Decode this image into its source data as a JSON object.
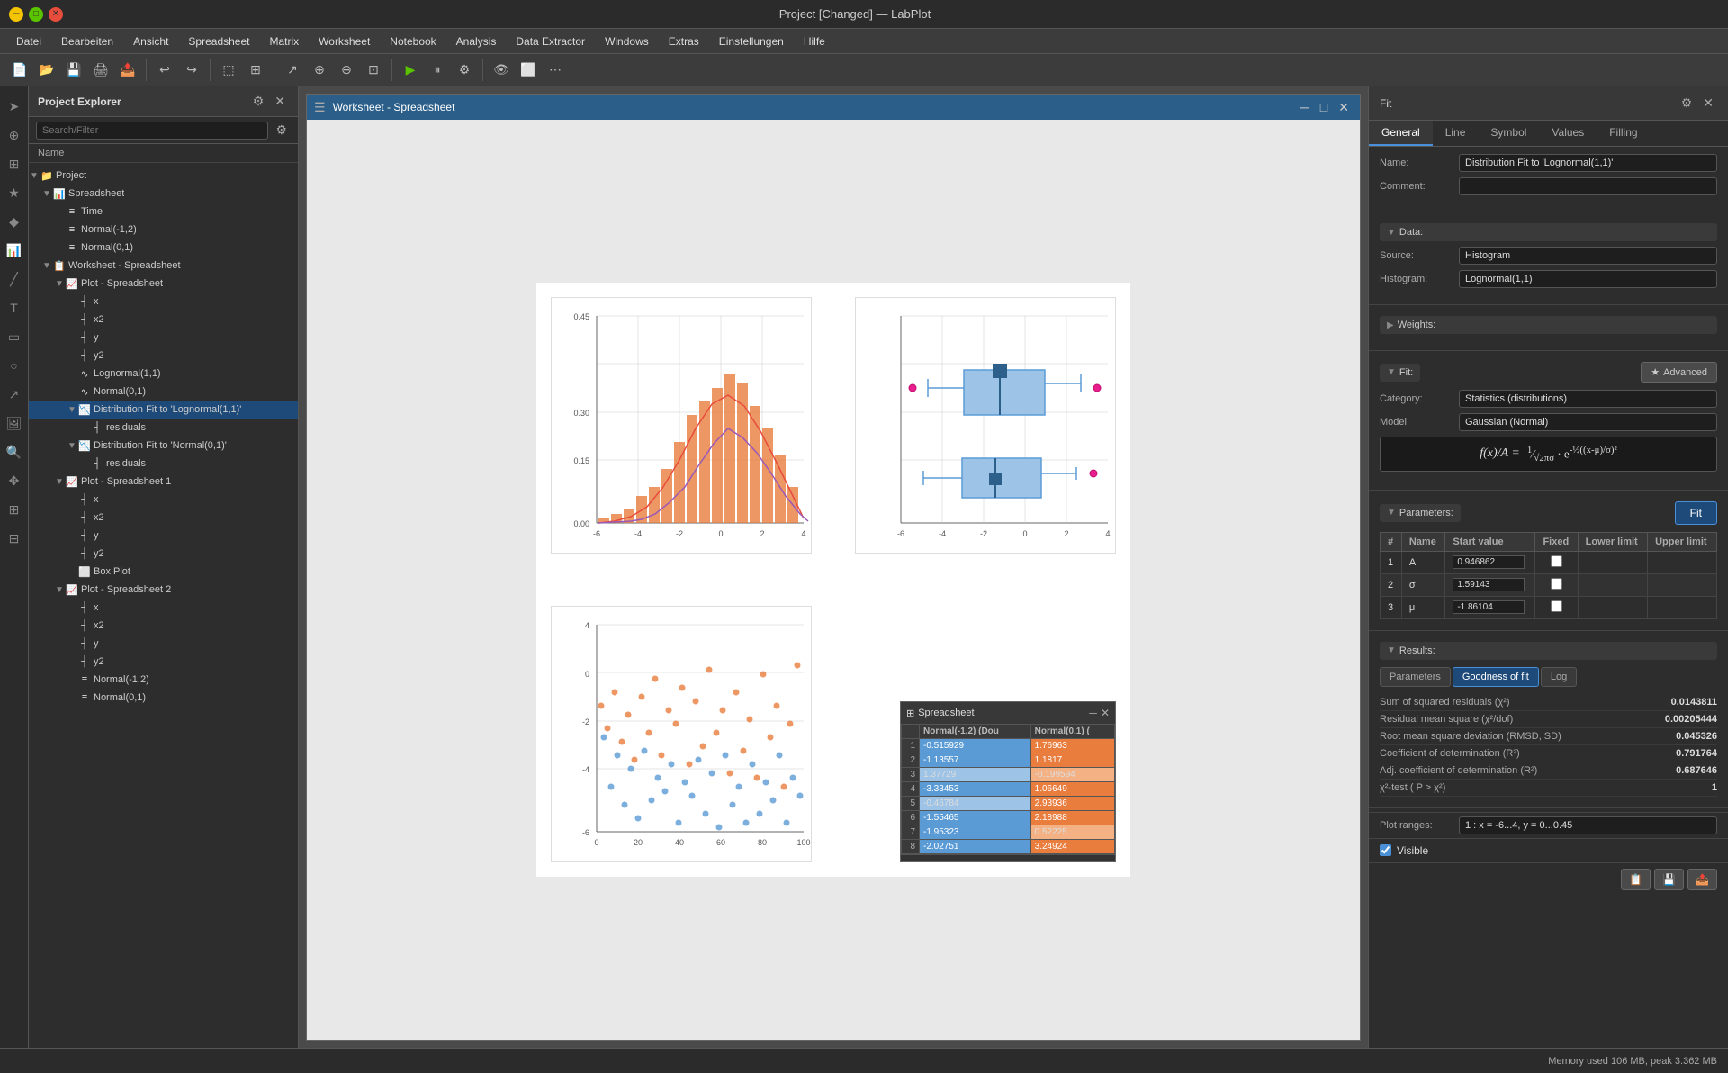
{
  "titlebar": {
    "title": "Project [Changed] — LabPlot",
    "min_label": "─",
    "max_label": "□",
    "close_label": "✕"
  },
  "menubar": {
    "items": [
      "Datei",
      "Bearbeiten",
      "Ansicht",
      "Spreadsheet",
      "Matrix",
      "Worksheet",
      "Notebook",
      "Analysis",
      "Data Extractor",
      "Windows",
      "Extras",
      "Einstellungen",
      "Hilfe"
    ]
  },
  "project_explorer": {
    "title": "Project Explorer",
    "search_placeholder": "Search/Filter",
    "col_header": "Name"
  },
  "tree": {
    "items": [
      {
        "id": "project",
        "label": "Project",
        "indent": 0,
        "icon": "📁",
        "expand": "▼"
      },
      {
        "id": "spreadsheet",
        "label": "Spreadsheet",
        "indent": 1,
        "icon": "📊",
        "expand": "▼"
      },
      {
        "id": "time",
        "label": "Time",
        "indent": 2,
        "icon": "≡",
        "expand": ""
      },
      {
        "id": "normal-1-2",
        "label": "Normal(-1,2)",
        "indent": 2,
        "icon": "≡",
        "expand": ""
      },
      {
        "id": "normal-0-1",
        "label": "Normal(0,1)",
        "indent": 2,
        "icon": "≡",
        "expand": ""
      },
      {
        "id": "worksheet-spreadsheet",
        "label": "Worksheet - Spreadsheet",
        "indent": 1,
        "icon": "📋",
        "expand": "▼"
      },
      {
        "id": "plot-spreadsheet",
        "label": "Plot - Spreadsheet",
        "indent": 2,
        "icon": "📈",
        "expand": "▼"
      },
      {
        "id": "x",
        "label": "x",
        "indent": 3,
        "icon": "┤",
        "expand": ""
      },
      {
        "id": "x2",
        "label": "x2",
        "indent": 3,
        "icon": "┤",
        "expand": ""
      },
      {
        "id": "y",
        "label": "y",
        "indent": 3,
        "icon": "┤",
        "expand": ""
      },
      {
        "id": "y2",
        "label": "y2",
        "indent": 3,
        "icon": "┤",
        "expand": ""
      },
      {
        "id": "lognormal",
        "label": "Lognormal(1,1)",
        "indent": 3,
        "icon": "∿",
        "expand": ""
      },
      {
        "id": "normal01",
        "label": "Normal(0,1)",
        "indent": 3,
        "icon": "∿",
        "expand": ""
      },
      {
        "id": "dist-lognormal",
        "label": "Distribution Fit to 'Lognormal(1,1)'",
        "indent": 3,
        "icon": "📉",
        "expand": "▼",
        "selected": true
      },
      {
        "id": "residuals1",
        "label": "residuals",
        "indent": 4,
        "icon": "┤",
        "expand": ""
      },
      {
        "id": "dist-normal",
        "label": "Distribution Fit to 'Normal(0,1)'",
        "indent": 3,
        "icon": "📉",
        "expand": "▼"
      },
      {
        "id": "residuals2",
        "label": "residuals",
        "indent": 4,
        "icon": "┤",
        "expand": ""
      },
      {
        "id": "plot-spreadsheet1",
        "label": "Plot - Spreadsheet 1",
        "indent": 2,
        "icon": "📈",
        "expand": "▼"
      },
      {
        "id": "x3",
        "label": "x",
        "indent": 3,
        "icon": "┤",
        "expand": ""
      },
      {
        "id": "x4",
        "label": "x2",
        "indent": 3,
        "icon": "┤",
        "expand": ""
      },
      {
        "id": "y3",
        "label": "y",
        "indent": 3,
        "icon": "┤",
        "expand": ""
      },
      {
        "id": "y4",
        "label": "y2",
        "indent": 3,
        "icon": "┤",
        "expand": ""
      },
      {
        "id": "boxplot",
        "label": "Box Plot",
        "indent": 3,
        "icon": "⬜",
        "expand": ""
      },
      {
        "id": "plot-spreadsheet2",
        "label": "Plot - Spreadsheet 2",
        "indent": 2,
        "icon": "📈",
        "expand": "▼"
      },
      {
        "id": "x5",
        "label": "x",
        "indent": 3,
        "icon": "┤",
        "expand": ""
      },
      {
        "id": "x6",
        "label": "x2",
        "indent": 3,
        "icon": "┤",
        "expand": ""
      },
      {
        "id": "y5",
        "label": "y",
        "indent": 3,
        "icon": "┤",
        "expand": ""
      },
      {
        "id": "y6",
        "label": "y2",
        "indent": 3,
        "icon": "┤",
        "expand": ""
      },
      {
        "id": "normal-1-2b",
        "label": "Normal(-1,2)",
        "indent": 3,
        "icon": "≡",
        "expand": ""
      },
      {
        "id": "normal-0-1b",
        "label": "Normal(0,1)",
        "indent": 3,
        "icon": "≡",
        "expand": ""
      }
    ]
  },
  "worksheet_window": {
    "title": "Worksheet - Spreadsheet"
  },
  "fit_panel": {
    "title": "Fit",
    "tabs": [
      "General",
      "Line",
      "Symbol",
      "Values",
      "Filling"
    ],
    "active_tab": "General",
    "name_label": "Name:",
    "name_value": "Distribution Fit to 'Lognormal(1,1)'",
    "comment_label": "Comment:",
    "comment_value": "",
    "data_section": "Data:",
    "source_label": "Source:",
    "source_value": "Histogram",
    "histogram_label": "Histogram:",
    "histogram_value": "Lognormal(1,1)",
    "weights_label": "Weights:",
    "fit_section": "Fit:",
    "advanced_label": "Advanced",
    "category_label": "Category:",
    "category_value": "Statistics (distributions)",
    "model_label": "Model:",
    "model_value": "Gaussian (Normal)",
    "formula_label": "f(x)/A =",
    "formula": "1/(√(2πσ²)) · e^(-½((x-μ)/σ)²)",
    "parameters_label": "Parameters:",
    "params_cols": [
      "Name",
      "Start value",
      "Fixed",
      "Lower limit",
      "Upper limit"
    ],
    "params_rows": [
      {
        "num": "1",
        "name": "A",
        "start_value": "0.946862",
        "fixed": false
      },
      {
        "num": "2",
        "name": "σ",
        "start_value": "1.59143",
        "fixed": false
      },
      {
        "num": "3",
        "name": "μ",
        "start_value": "-1.86104",
        "fixed": false
      }
    ],
    "fit_btn_label": "Fit",
    "results_label": "Results:",
    "results_tabs": [
      "Parameters",
      "Goodness of fit",
      "Log"
    ],
    "active_results_tab": "Goodness of fit",
    "goodness_rows": [
      {
        "name": "Sum of squared residuals (χ²)",
        "value": "0.0143811"
      },
      {
        "name": "Residual mean square (χ²/dof)",
        "value": "0.00205444"
      },
      {
        "name": "Root mean square deviation (RMSD, SD)",
        "value": "0.045326"
      },
      {
        "name": "Coefficient of determination (R²)",
        "value": "0.791764"
      },
      {
        "name": "Adj. coefficient of determination (R²)",
        "value": "0.687646"
      },
      {
        "name": "χ²-test ( P > χ²)",
        "value": "1"
      }
    ],
    "plot_ranges_label": "Plot ranges:",
    "plot_ranges_value": "1 : x = -6...4, y = 0...0.45",
    "visible_label": "Visible",
    "visible_checked": true
  },
  "spreadsheet_overlay": {
    "title": "Spreadsheet",
    "cols": [
      "Normal(-1,2) (Dou",
      "Normal(0,1) ("
    ],
    "rows": [
      {
        "num": "1",
        "col1": "-0.515929",
        "col2": "1.76963",
        "c1_style": "blue",
        "c2_style": "orange"
      },
      {
        "num": "2",
        "col1": "-1.13557",
        "col2": "1.1817",
        "c1_style": "blue",
        "c2_style": "orange"
      },
      {
        "num": "3",
        "col1": "1.37729",
        "col2": "-0.199594",
        "c1_style": "light-blue",
        "c2_style": "light-orange"
      },
      {
        "num": "4",
        "col1": "-3.33453",
        "col2": "1.06649",
        "c1_style": "blue",
        "c2_style": "orange"
      },
      {
        "num": "5",
        "col1": "-0.46784",
        "col2": "2.93936",
        "c1_style": "light-blue",
        "c2_style": "orange"
      },
      {
        "num": "6",
        "col1": "-1.55465",
        "col2": "2.18988",
        "c1_style": "blue",
        "c2_style": "orange"
      },
      {
        "num": "7",
        "col1": "-1.95323",
        "col2": "0.52225",
        "c1_style": "blue",
        "c2_style": "light-orange"
      },
      {
        "num": "8",
        "col1": "-2.02751",
        "col2": "3.24924",
        "c1_style": "blue",
        "c2_style": "orange"
      }
    ]
  },
  "status_bar": {
    "memory_text": "Memory used 106 MB, peak 3.362 MB"
  }
}
